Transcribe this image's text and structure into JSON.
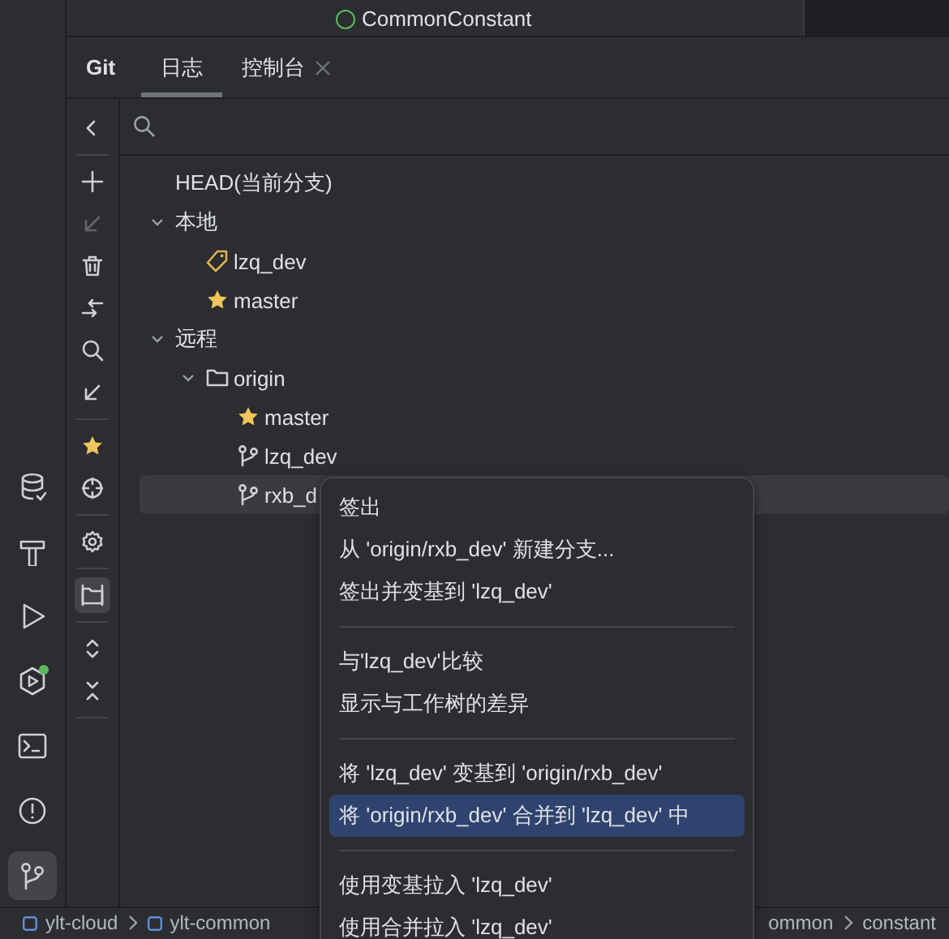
{
  "editor_tab": {
    "title": "CommonConstant"
  },
  "tool_window": {
    "title": "Git",
    "tabs": [
      {
        "label": "日志",
        "selected": true,
        "closable": false
      },
      {
        "label": "控制台",
        "selected": false,
        "closable": true
      }
    ]
  },
  "left_stripe": [
    {
      "selected": false,
      "notification": false
    },
    {
      "selected": false,
      "notification": false
    },
    {
      "selected": false,
      "notification": false
    },
    {
      "selected": false,
      "notification": true
    },
    {
      "selected": false,
      "notification": false
    },
    {
      "selected": false,
      "notification": false
    },
    {
      "selected": true,
      "notification": false
    }
  ],
  "toolbar": [
    {
      "disabled": false,
      "selected": false
    },
    {
      "disabled": false,
      "selected": false
    },
    {
      "disabled": true,
      "selected": false
    },
    {
      "disabled": false,
      "selected": false
    },
    {
      "disabled": false,
      "selected": false
    },
    {
      "disabled": false,
      "selected": false
    },
    {
      "disabled": false,
      "selected": false
    },
    {
      "disabled": false,
      "selected": false
    },
    {
      "disabled": false,
      "selected": false
    },
    {
      "disabled": false,
      "selected": false
    },
    {
      "disabled": false,
      "selected": true
    },
    {
      "disabled": false,
      "selected": false
    },
    {
      "disabled": false,
      "selected": false
    }
  ],
  "branches": [
    {
      "label": "HEAD(当前分支)",
      "selected": false
    },
    {
      "label": "本地",
      "expanded": true,
      "selected": false,
      "children": [
        {
          "label": "lzq_dev",
          "kind": "tag",
          "selected": false
        },
        {
          "label": "master",
          "kind": "star",
          "selected": false
        }
      ]
    },
    {
      "label": "远程",
      "expanded": true,
      "selected": false,
      "children": [
        {
          "label": "origin",
          "kind": "folder",
          "expanded": true,
          "selected": false,
          "children": [
            {
              "label": "master",
              "kind": "star",
              "selected": false
            },
            {
              "label": "lzq_dev",
              "kind": "branch",
              "selected": false
            },
            {
              "label": "rxb_d",
              "kind": "branch",
              "selected": true
            }
          ]
        }
      ]
    }
  ],
  "context_menu": [
    [
      {
        "label": "签出",
        "selected": false
      },
      {
        "label": "从 'origin/rxb_dev' 新建分支...",
        "selected": false
      },
      {
        "label": "签出并变基到 'lzq_dev'",
        "selected": false
      }
    ],
    [
      {
        "label": "与'lzq_dev'比较",
        "selected": false
      },
      {
        "label": "显示与工作树的差异",
        "selected": false
      }
    ],
    [
      {
        "label": "将 'lzq_dev' 变基到 'origin/rxb_dev'",
        "selected": false
      },
      {
        "label": "将 'origin/rxb_dev' 合并到 'lzq_dev' 中",
        "selected": true
      }
    ],
    [
      {
        "label": "使用变基拉入 'lzq_dev'",
        "selected": false
      },
      {
        "label": "使用合并拉入 'lzq_dev'",
        "selected": false
      }
    ]
  ],
  "breadcrumbs_left": [
    "ylt-cloud",
    "ylt-common"
  ],
  "breadcrumbs_right": [
    "ommon",
    "constant"
  ]
}
